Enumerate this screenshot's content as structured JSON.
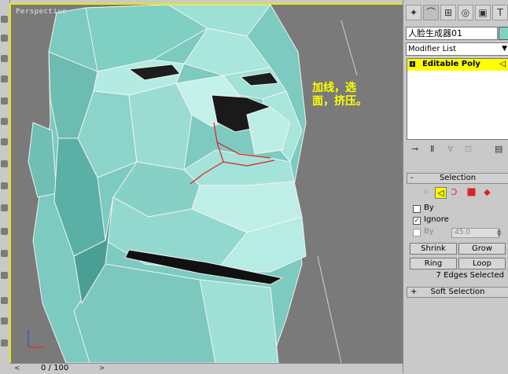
{
  "viewport": {
    "label": "Perspective",
    "annotation_line1": "加线，选",
    "annotation_line2": "面，挤压。"
  },
  "timeline": {
    "frame": "0 / 100"
  },
  "panel": {
    "object_name": "人脸生成器01",
    "object_color": "#7fd1c6",
    "modifier_list": "Modifier List",
    "stack_item": "Editable Poly",
    "selection": {
      "title": "Selection",
      "by_label": "By",
      "ignore_label": "Ignore",
      "by_angle_label": "By",
      "angle_value": "45.0",
      "shrink": "Shrink",
      "grow": "Grow",
      "ring": "Ring",
      "loop": "Loop",
      "status": "7 Edges Selected"
    },
    "soft_selection_title": "Soft Selection"
  },
  "colors": {
    "viewport_border": "#e8e800",
    "mesh": "#8fd6cc",
    "highlight": "#ffff00"
  }
}
